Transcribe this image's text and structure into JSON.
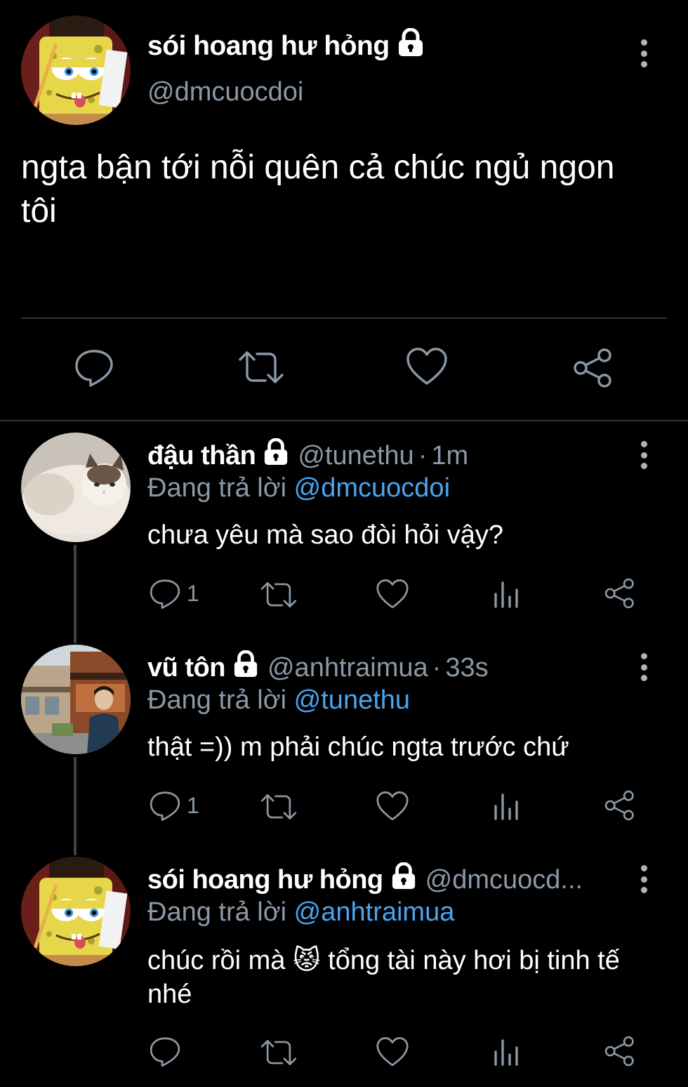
{
  "main_tweet": {
    "author_name": "sói hoang hư hỏng",
    "author_handle": "@dmcuocdoi",
    "text": "ngta bận tới nỗi quên cả chúc ngủ ngon tôi"
  },
  "replies": [
    {
      "author_name": "đậu thần",
      "author_handle": "@tunethu",
      "separator": "·",
      "time": "1m",
      "replying_label": "Đang trả lời",
      "replying_to": "@dmcuocdoi",
      "text": "chưa yêu mà sao đòi hỏi vậy?",
      "reply_count": "1"
    },
    {
      "author_name": "vũ tôn",
      "author_handle": "@anhtraimua",
      "separator": "·",
      "time": "33s",
      "replying_label": "Đang trả lời",
      "replying_to": "@tunethu",
      "text": "thật =)) m phải chúc ngta trước chứ",
      "reply_count": "1"
    },
    {
      "author_name": "sói hoang hư hỏng",
      "author_handle": "@dmcuocd...",
      "replying_label": "Đang trả lời",
      "replying_to": "@anhtraimua",
      "text": "chúc rồi mà 😾 tổng tài này hơi bị tinh tế nhé",
      "reply_count": ""
    }
  ],
  "icons": {
    "reply": "comment-bubble-icon",
    "retweet": "retweet-icon",
    "like": "heart-icon",
    "analytics": "analytics-bars-icon",
    "share": "share-icon",
    "lock": "lock-icon",
    "more": "more-vertical-icon"
  },
  "colors": {
    "background": "#000000",
    "text": "#ffffff",
    "secondary": "#8b98a5",
    "mention": "#4aa4ee",
    "divider": "#2f3336"
  }
}
